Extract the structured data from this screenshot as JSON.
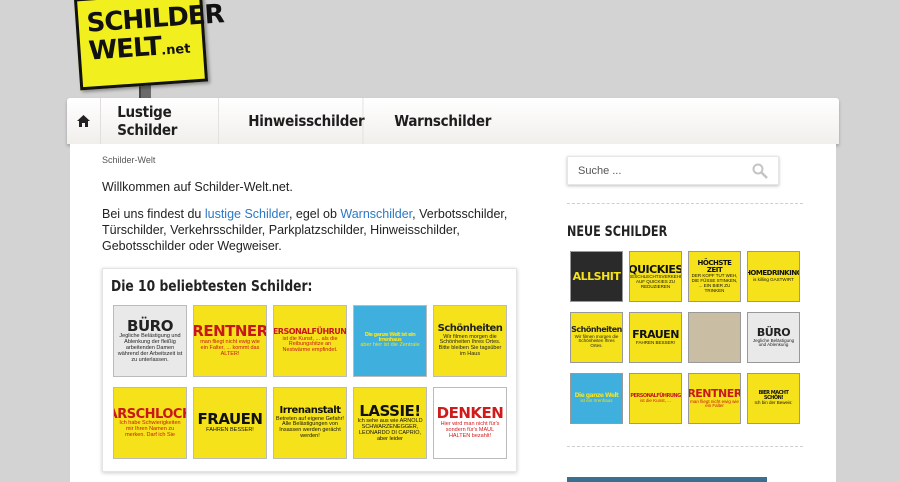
{
  "logo": {
    "line1": "SCHILDER",
    "line2": "WELT",
    "tld": ".net"
  },
  "nav": {
    "home_icon": "home-icon",
    "items": [
      {
        "label": "Lustige Schilder"
      },
      {
        "label": "Hinweisschilder"
      },
      {
        "label": "Warnschilder"
      }
    ]
  },
  "main": {
    "breadcrumb": "Schilder-Welt",
    "welcome": "Willkommen auf Schilder-Welt.net.",
    "intro": {
      "p1": "Bei uns findest du ",
      "link1": "lustige Schilder",
      "p2": ", egel ob ",
      "link2": "Warnschilder",
      "p3": ", Verbotsschilder, Türschilder, Verkehrsschilder, Parkplatzschilder, Hinweisschilder, Gebotsschilder oder Wegweiser."
    },
    "top10": {
      "title": "Die 10 beliebtesten Schilder:",
      "items": [
        {
          "big": "BÜRO",
          "text": "Jegliche Belästigung und Ablenkung der fleißig arbeitenden Damen während der Arbeitszeit ist zu unterlassen.",
          "bg": "#e9e9e9",
          "fg": "#222"
        },
        {
          "big": "RENTNER",
          "text": "man fliegt nicht ewig wie ein Falter, ... kommt das ALTER!",
          "bg": "#f5e21a",
          "fg": "#c8161d"
        },
        {
          "big": "PERSONALFÜHRUNG",
          "text": "ist die Kunst, ... als die Reibungshitze an Nestwärme empfindet.",
          "bg": "#f5e21a",
          "fg": "#c8161d"
        },
        {
          "big": "Die ganze Welt ist ein Irrenhaus",
          "text": "aber hier ist die Zentrale",
          "bg": "#3fb0dd",
          "fg": "#f5e21a"
        },
        {
          "big": "Schönheiten",
          "text": "Wir filmen morgen die Schönheiten Ihres Ortes. Bitte bleiben Sie tagsüber im Haus",
          "bg": "#f5e21a",
          "fg": "#222"
        },
        {
          "big": "ARSCHLOCH",
          "text": "Ich habe Schwierigkeiten mir Ihren Namen zu merken. Darf ich Sie",
          "bg": "#f5e21a",
          "fg": "#c8161d"
        },
        {
          "big": "FRAUEN",
          "text": "FAHREN BESSER!",
          "bg": "#f5e21a",
          "fg": "#111"
        },
        {
          "big": "Irrenanstalt",
          "text": "Betreten auf eigene Gefahr! Alle Belästigungen von Insassen werden gerächt werden!",
          "bg": "#f5e21a",
          "fg": "#111"
        },
        {
          "big": "LASSIE!",
          "text": "Ich sehe aus wie ARNOLD SCHWARZENEGGER, LEONARDO DI CAPRIO, aber leider",
          "bg": "#f5e21a",
          "fg": "#111"
        },
        {
          "big": "DENKEN",
          "text": "Hier wird man nicht für's sondern für's MAUL HALTEN bezahlt!",
          "bg": "#ffffff",
          "fg": "#d11a1a"
        }
      ]
    }
  },
  "sidebar": {
    "search_placeholder": "Suche ...",
    "search_icon": "magnifier-icon",
    "title": "NEUE SCHILDER",
    "items": [
      {
        "big": "ALLSHIT",
        "text": "",
        "bg": "#2a2a2a",
        "fg": "#f5e21a"
      },
      {
        "big": "QUICKIES",
        "text": "GESCHLECHTSVERKEHR AUF QUICKIES ZU REDUZIEREN",
        "bg": "#f5e21a",
        "fg": "#111"
      },
      {
        "big": "HÖCHSTE ZEIT",
        "text": "DER KOPF TUT WEH, DIE FÜSSE STINKEN, ... EIN BIER ZU TRINKEN",
        "bg": "#f5e21a",
        "fg": "#111"
      },
      {
        "big": "HOMEDRINKING",
        "text": "is killing GASTWIRT",
        "bg": "#f5e21a",
        "fg": "#111"
      },
      {
        "big": "Schönheiten",
        "text": "Wir filmen morgen die Schönheiten Ihres Ortes.",
        "bg": "#f5e21a",
        "fg": "#222"
      },
      {
        "big": "FRAUEN",
        "text": "FAHREN BESSER!",
        "bg": "#f5e21a",
        "fg": "#111"
      },
      {
        "big": "",
        "text": "",
        "bg": "#c9bea4",
        "fg": "#333"
      },
      {
        "big": "BÜRO",
        "text": "Jegliche Belästigung und Ablenkung",
        "bg": "#e9e9e9",
        "fg": "#222"
      },
      {
        "big": "Die ganze Welt",
        "text": "ist ein Irrenhaus",
        "bg": "#3fb0dd",
        "fg": "#f5e21a"
      },
      {
        "big": "PERSONALFÜHRUNG",
        "text": "ist die Kunst, ...",
        "bg": "#f5e21a",
        "fg": "#c8161d"
      },
      {
        "big": "RENTNER",
        "text": "man fliegt nicht ewig wie ein Falter",
        "bg": "#f5e21a",
        "fg": "#c8161d"
      },
      {
        "big": "BIER MACHT SCHÖN!",
        "text": "Ich bin der Beweis:",
        "bg": "#f5e21a",
        "fg": "#111"
      }
    ]
  }
}
